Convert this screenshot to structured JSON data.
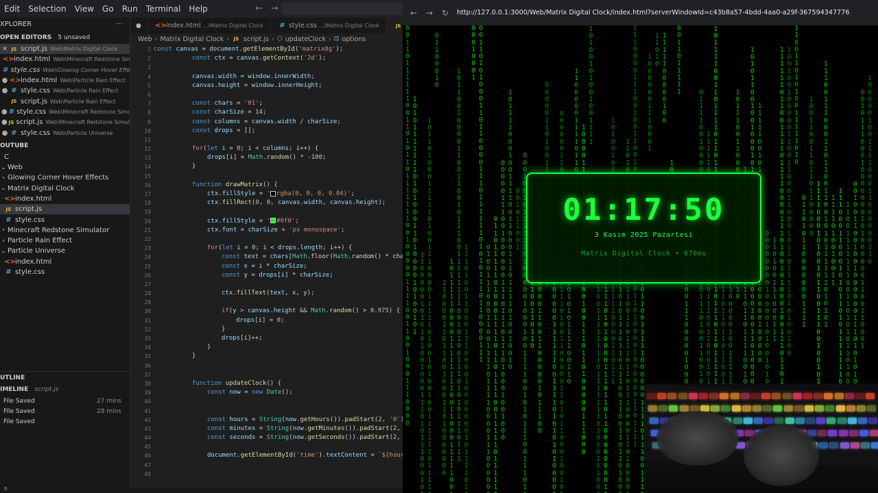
{
  "menubar": {
    "items": [
      "Edit",
      "Selection",
      "View",
      "Go",
      "Run",
      "Terminal",
      "Help"
    ]
  },
  "sidebar": {
    "explorer_title": "XPLORER",
    "open_editors_title": "OPEN EDITORS",
    "unsaved_badge": "5 unsaved",
    "open_editors": [
      {
        "name": "script.js",
        "path": "Web\\Matrix Digital Clock",
        "type": "js",
        "marker": "close",
        "active": true
      },
      {
        "name": "index.html",
        "path": "Web\\Minecraft Redstone Simul...",
        "type": "html",
        "marker": "none",
        "active": false
      },
      {
        "name": "style.css",
        "path": "Web\\Glowing Corner Hover Effects",
        "type": "css",
        "marker": "none",
        "active": false,
        "italic": true
      },
      {
        "name": "index.html",
        "path": "Web\\Particle Rain Effect",
        "type": "html",
        "marker": "dot",
        "active": false
      },
      {
        "name": "style.css",
        "path": "Web\\Particle Rain Effect",
        "type": "css",
        "marker": "dot",
        "active": false
      },
      {
        "name": "script.js",
        "path": "Web\\Particle Rain Effect",
        "type": "js",
        "marker": "none",
        "active": false
      },
      {
        "name": "style.css",
        "path": "Web\\Minecraft Redstone Simulator",
        "type": "css",
        "marker": "dot",
        "active": false
      },
      {
        "name": "script.js",
        "path": "Web\\Minecraft Redstone Simulator",
        "type": "js",
        "marker": "dot",
        "active": false
      },
      {
        "name": "style.css",
        "path": "Web\\Particle Universe",
        "type": "css",
        "marker": "dot",
        "active": false
      }
    ],
    "youtube_title": "OUTUBE",
    "tree": [
      {
        "label": "C",
        "kind": "folder-plain",
        "indent": 6
      },
      {
        "label": "Web",
        "kind": "folder-open",
        "indent": 0
      },
      {
        "label": "Glowing Corner Hover Effects",
        "kind": "folder-closed",
        "indent": 0
      },
      {
        "label": "Matrix Digital Clock",
        "kind": "folder-open",
        "indent": 0
      },
      {
        "label": "index.html",
        "kind": "html",
        "indent": 4
      },
      {
        "label": "script.js",
        "kind": "js",
        "indent": 4,
        "active": true
      },
      {
        "label": "style.css",
        "kind": "css",
        "indent": 4
      },
      {
        "label": "Minecraft Redstone Simulator",
        "kind": "folder-closed",
        "indent": 0
      },
      {
        "label": "Particle Rain Effect",
        "kind": "folder-closed",
        "indent": 0
      },
      {
        "label": "Particle Universe",
        "kind": "folder-open",
        "indent": 0
      },
      {
        "label": "index.html",
        "kind": "html",
        "indent": 4
      },
      {
        "label": "style.css",
        "kind": "css",
        "indent": 4
      }
    ],
    "outline_title": "UTLINE",
    "timeline_title": "IMELINE",
    "timeline_file": "script.js",
    "timeline": [
      {
        "label": "File Saved",
        "time": "27 mins"
      },
      {
        "label": "File Saved",
        "time": "28 mins"
      },
      {
        "label": "File Saved",
        "time": ""
      }
    ]
  },
  "tabs": [
    {
      "name": "index.html",
      "path": "...\\Matrix Digital Clock",
      "type": "html",
      "active": false
    },
    {
      "name": "style.css",
      "path": "...\\Matrix Digital Clock",
      "type": "css",
      "active": false
    },
    {
      "name": "script.js",
      "path": "",
      "type": "js",
      "active": true
    }
  ],
  "breadcrumb": [
    "Web",
    "Matrix Digital Clock",
    "script.js",
    "updateClock",
    "options"
  ],
  "statusbar": {
    "errors": "0"
  },
  "browser": {
    "url": "http://127.0.0.1:3000/Web/Matrix Digital Clock/index.html?serverWindowId=c43b8a57-4bdd-4aa0-a29f-367594347776"
  },
  "clock": {
    "time": "01:17:50",
    "date": "3 Kasım 2025 Pazartesi",
    "subtitle": "Matrix Digital Clock • 670ms"
  },
  "colors": {
    "matrix_green": "#0bd60b",
    "clock_green": "#1bff3f",
    "editor_bg": "#1f1f1f",
    "sidebar_bg": "#181818"
  }
}
